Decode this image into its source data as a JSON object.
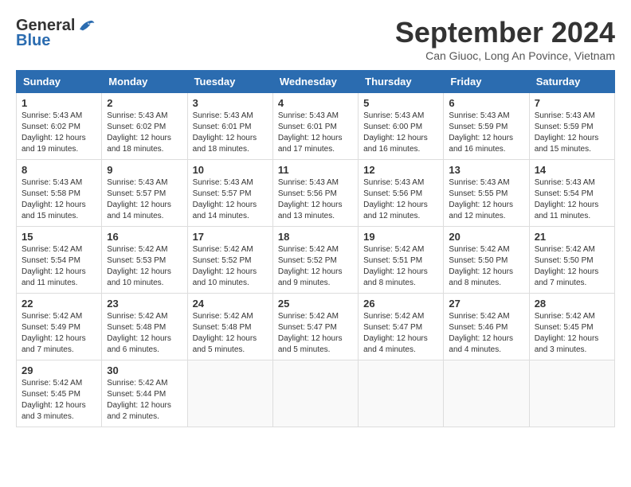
{
  "header": {
    "logo_line1": "General",
    "logo_line2": "Blue",
    "title": "September 2024",
    "subtitle": "Can Giuoc, Long An Povince, Vietnam"
  },
  "columns": [
    "Sunday",
    "Monday",
    "Tuesday",
    "Wednesday",
    "Thursday",
    "Friday",
    "Saturday"
  ],
  "weeks": [
    [
      {
        "day": "1",
        "info": "Sunrise: 5:43 AM\nSunset: 6:02 PM\nDaylight: 12 hours\nand 19 minutes."
      },
      {
        "day": "2",
        "info": "Sunrise: 5:43 AM\nSunset: 6:02 PM\nDaylight: 12 hours\nand 18 minutes."
      },
      {
        "day": "3",
        "info": "Sunrise: 5:43 AM\nSunset: 6:01 PM\nDaylight: 12 hours\nand 18 minutes."
      },
      {
        "day": "4",
        "info": "Sunrise: 5:43 AM\nSunset: 6:01 PM\nDaylight: 12 hours\nand 17 minutes."
      },
      {
        "day": "5",
        "info": "Sunrise: 5:43 AM\nSunset: 6:00 PM\nDaylight: 12 hours\nand 16 minutes."
      },
      {
        "day": "6",
        "info": "Sunrise: 5:43 AM\nSunset: 5:59 PM\nDaylight: 12 hours\nand 16 minutes."
      },
      {
        "day": "7",
        "info": "Sunrise: 5:43 AM\nSunset: 5:59 PM\nDaylight: 12 hours\nand 15 minutes."
      }
    ],
    [
      {
        "day": "8",
        "info": "Sunrise: 5:43 AM\nSunset: 5:58 PM\nDaylight: 12 hours\nand 15 minutes."
      },
      {
        "day": "9",
        "info": "Sunrise: 5:43 AM\nSunset: 5:57 PM\nDaylight: 12 hours\nand 14 minutes."
      },
      {
        "day": "10",
        "info": "Sunrise: 5:43 AM\nSunset: 5:57 PM\nDaylight: 12 hours\nand 14 minutes."
      },
      {
        "day": "11",
        "info": "Sunrise: 5:43 AM\nSunset: 5:56 PM\nDaylight: 12 hours\nand 13 minutes."
      },
      {
        "day": "12",
        "info": "Sunrise: 5:43 AM\nSunset: 5:56 PM\nDaylight: 12 hours\nand 12 minutes."
      },
      {
        "day": "13",
        "info": "Sunrise: 5:43 AM\nSunset: 5:55 PM\nDaylight: 12 hours\nand 12 minutes."
      },
      {
        "day": "14",
        "info": "Sunrise: 5:43 AM\nSunset: 5:54 PM\nDaylight: 12 hours\nand 11 minutes."
      }
    ],
    [
      {
        "day": "15",
        "info": "Sunrise: 5:42 AM\nSunset: 5:54 PM\nDaylight: 12 hours\nand 11 minutes."
      },
      {
        "day": "16",
        "info": "Sunrise: 5:42 AM\nSunset: 5:53 PM\nDaylight: 12 hours\nand 10 minutes."
      },
      {
        "day": "17",
        "info": "Sunrise: 5:42 AM\nSunset: 5:52 PM\nDaylight: 12 hours\nand 10 minutes."
      },
      {
        "day": "18",
        "info": "Sunrise: 5:42 AM\nSunset: 5:52 PM\nDaylight: 12 hours\nand 9 minutes."
      },
      {
        "day": "19",
        "info": "Sunrise: 5:42 AM\nSunset: 5:51 PM\nDaylight: 12 hours\nand 8 minutes."
      },
      {
        "day": "20",
        "info": "Sunrise: 5:42 AM\nSunset: 5:50 PM\nDaylight: 12 hours\nand 8 minutes."
      },
      {
        "day": "21",
        "info": "Sunrise: 5:42 AM\nSunset: 5:50 PM\nDaylight: 12 hours\nand 7 minutes."
      }
    ],
    [
      {
        "day": "22",
        "info": "Sunrise: 5:42 AM\nSunset: 5:49 PM\nDaylight: 12 hours\nand 7 minutes."
      },
      {
        "day": "23",
        "info": "Sunrise: 5:42 AM\nSunset: 5:48 PM\nDaylight: 12 hours\nand 6 minutes."
      },
      {
        "day": "24",
        "info": "Sunrise: 5:42 AM\nSunset: 5:48 PM\nDaylight: 12 hours\nand 5 minutes."
      },
      {
        "day": "25",
        "info": "Sunrise: 5:42 AM\nSunset: 5:47 PM\nDaylight: 12 hours\nand 5 minutes."
      },
      {
        "day": "26",
        "info": "Sunrise: 5:42 AM\nSunset: 5:47 PM\nDaylight: 12 hours\nand 4 minutes."
      },
      {
        "day": "27",
        "info": "Sunrise: 5:42 AM\nSunset: 5:46 PM\nDaylight: 12 hours\nand 4 minutes."
      },
      {
        "day": "28",
        "info": "Sunrise: 5:42 AM\nSunset: 5:45 PM\nDaylight: 12 hours\nand 3 minutes."
      }
    ],
    [
      {
        "day": "29",
        "info": "Sunrise: 5:42 AM\nSunset: 5:45 PM\nDaylight: 12 hours\nand 3 minutes."
      },
      {
        "day": "30",
        "info": "Sunrise: 5:42 AM\nSunset: 5:44 PM\nDaylight: 12 hours\nand 2 minutes."
      },
      {
        "day": "",
        "info": ""
      },
      {
        "day": "",
        "info": ""
      },
      {
        "day": "",
        "info": ""
      },
      {
        "day": "",
        "info": ""
      },
      {
        "day": "",
        "info": ""
      }
    ]
  ]
}
